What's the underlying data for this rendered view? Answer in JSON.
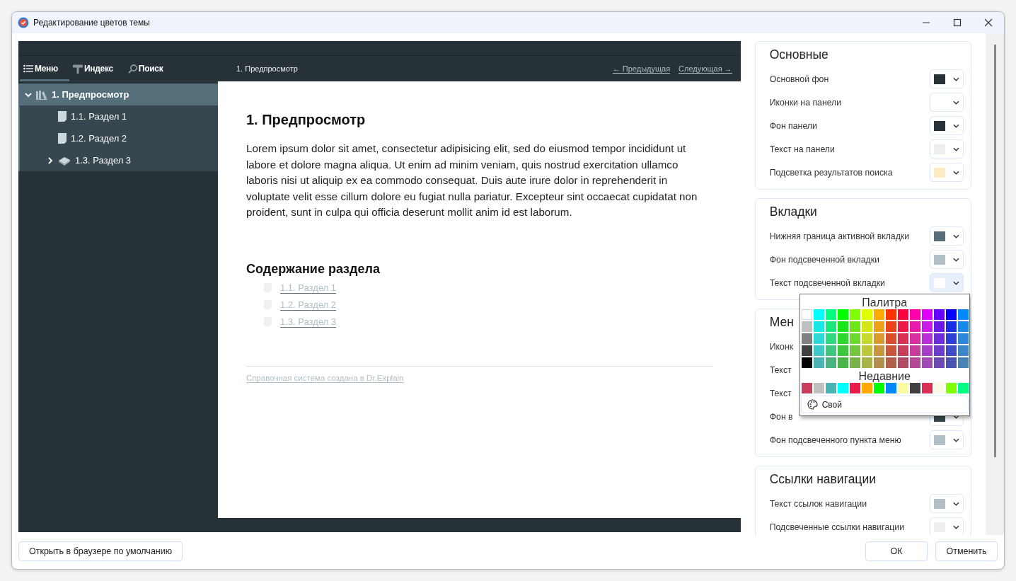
{
  "window": {
    "title": "Редактирование цветов темы"
  },
  "preview": {
    "tabs": [
      {
        "label": "Меню",
        "selected": true
      },
      {
        "label": "Индекс",
        "selected": false
      },
      {
        "label": "Поиск",
        "selected": false
      }
    ],
    "breadcrumb": "1. Предпросмотр",
    "prev_link": "← Предыдущая",
    "next_link": "Следующая →",
    "tree": [
      {
        "label": "1. Предпросмотр",
        "selected": true,
        "expanded": true,
        "children": [
          {
            "label": "1.1. Раздел 1",
            "selected": false
          },
          {
            "label": "1.2. Раздел 2",
            "selected": false
          },
          {
            "label": "1.3. Раздел 3",
            "selected": false,
            "expanded": false
          }
        ]
      }
    ],
    "heading": "1. Предпросмотр",
    "paragraph": "Lorem ipsum dolor sit amet, consectetur adipisicing elit, sed do eiusmod tempor incididunt ut labore et dolore magna aliqua. Ut enim ad minim veniam, quis nostrud exercitation ullamco laboris nisi ut aliquip ex ea commodo consequat. Duis aute irure dolor in reprehenderit in voluptate velit esse cillum dolore eu fugiat nulla pariatur. Excepteur sint occaecat cupidatat non proident, sunt in culpa qui officia deserunt mollit anim id est laborum.",
    "contents_heading": "Содержание раздела",
    "contents_links": [
      "1.1. Раздел 1",
      "1.2. Раздел 2",
      "1.3. Раздел 3"
    ],
    "footer_link": "Справочная система создана в Dr.Explain"
  },
  "sections": [
    {
      "title": "Основные",
      "rows": [
        {
          "label": "Основной фон",
          "color": "#263238",
          "open": false
        },
        {
          "label": "Иконки на панели",
          "color": "#ffffff",
          "open": false
        },
        {
          "label": "Фон панели",
          "color": "#263238",
          "open": false
        },
        {
          "label": "Текст на панели",
          "color": "#eeeeee",
          "open": false
        },
        {
          "label": "Подсветка результатов поиска",
          "color": "#ffecc6",
          "open": false
        }
      ]
    },
    {
      "title": "Вкладки",
      "rows": [
        {
          "label": "Нижняя граница активной вкладки",
          "color": "#546e7a",
          "open": false
        },
        {
          "label": "Фон подсвеченной вкладки",
          "color": "#b0bec5",
          "open": false
        },
        {
          "label": "Текст подсвеченной вкладки",
          "color": "#ffffff",
          "open": true
        }
      ]
    },
    {
      "title": "Мен",
      "rows": [
        {
          "label": "Иконк"
        },
        {
          "label": "Текст"
        },
        {
          "label": "Текст"
        },
        {
          "label": "Фон в",
          "color": "#37474f",
          "open": false
        },
        {
          "label": "Фон подсвеченного пункта меню",
          "color": "#b0bec5",
          "open": false
        }
      ]
    },
    {
      "title": "Ссылки навигации",
      "rows": [
        {
          "label": "Текст ссылок навигации",
          "color": "#b0bec5",
          "open": false
        },
        {
          "label": "Подсвеченные ссылки навигации",
          "color": "#eeeeee",
          "open": false
        }
      ]
    }
  ],
  "palette": {
    "title": "Палитра",
    "rows": [
      [
        {
          "color": "#ffffff",
          "selected": true
        },
        {
          "color": "#00ffff",
          "selected": false
        },
        {
          "color": "#00ff80",
          "selected": false
        },
        {
          "color": "#00ff00",
          "selected": false
        },
        {
          "color": "#80ff00",
          "selected": false
        },
        {
          "color": "#e0ff00",
          "selected": false
        },
        {
          "color": "#ffaa00",
          "selected": false
        },
        {
          "color": "#ff3300",
          "selected": false
        },
        {
          "color": "#ff0040",
          "selected": false
        },
        {
          "color": "#ff00aa",
          "selected": false
        },
        {
          "color": "#dd00ff",
          "selected": false
        },
        {
          "color": "#6600ff",
          "selected": false
        },
        {
          "color": "#0000ff",
          "selected": false
        },
        {
          "color": "#0088ff",
          "selected": false
        }
      ],
      [
        {
          "color": "#c0c0c0",
          "selected": false
        },
        {
          "color": "#1ae6e6",
          "selected": false
        },
        {
          "color": "#1ae680",
          "selected": false
        },
        {
          "color": "#1ae61a",
          "selected": false
        },
        {
          "color": "#6ee61a",
          "selected": false
        },
        {
          "color": "#d4e61a",
          "selected": false
        },
        {
          "color": "#eba21a",
          "selected": false
        },
        {
          "color": "#eb431a",
          "selected": false
        },
        {
          "color": "#eb1a4a",
          "selected": false
        },
        {
          "color": "#e81aaa",
          "selected": false
        },
        {
          "color": "#c91ae6",
          "selected": false
        },
        {
          "color": "#6a1ae6",
          "selected": false
        },
        {
          "color": "#1a2ee6",
          "selected": false
        },
        {
          "color": "#1a88e6",
          "selected": false
        }
      ],
      [
        {
          "color": "#808080",
          "selected": false
        },
        {
          "color": "#2ed9d9",
          "selected": false
        },
        {
          "color": "#2ed980",
          "selected": false
        },
        {
          "color": "#2ed92e",
          "selected": false
        },
        {
          "color": "#6ed92e",
          "selected": false
        },
        {
          "color": "#c8d92e",
          "selected": false
        },
        {
          "color": "#d99a2e",
          "selected": false
        },
        {
          "color": "#d94d2e",
          "selected": false
        },
        {
          "color": "#d92e55",
          "selected": false
        },
        {
          "color": "#d92ea0",
          "selected": false
        },
        {
          "color": "#b82ed9",
          "selected": false
        },
        {
          "color": "#6b2ed9",
          "selected": false
        },
        {
          "color": "#2e3fd9",
          "selected": false
        },
        {
          "color": "#2e88d9",
          "selected": false
        }
      ],
      [
        {
          "color": "#404040",
          "selected": false
        },
        {
          "color": "#3dc7c7",
          "selected": false
        },
        {
          "color": "#3dc780",
          "selected": false
        },
        {
          "color": "#3dc73d",
          "selected": false
        },
        {
          "color": "#73c73d",
          "selected": false
        },
        {
          "color": "#bcc73d",
          "selected": false
        },
        {
          "color": "#c7963d",
          "selected": false
        },
        {
          "color": "#c7573d",
          "selected": false
        },
        {
          "color": "#c73d5c",
          "selected": false
        },
        {
          "color": "#c73d9c",
          "selected": false
        },
        {
          "color": "#a83dc7",
          "selected": false
        },
        {
          "color": "#6c3dc7",
          "selected": false
        },
        {
          "color": "#3d4bc7",
          "selected": false
        },
        {
          "color": "#3d86c7",
          "selected": false
        }
      ],
      [
        {
          "color": "#000000",
          "selected": false
        },
        {
          "color": "#4ab3b3",
          "selected": false
        },
        {
          "color": "#4ab380",
          "selected": false
        },
        {
          "color": "#4ab34a",
          "selected": false
        },
        {
          "color": "#7ab34a",
          "selected": false
        },
        {
          "color": "#aab34a",
          "selected": false
        },
        {
          "color": "#b38f4a",
          "selected": false
        },
        {
          "color": "#b3604a",
          "selected": false
        },
        {
          "color": "#b34a63",
          "selected": false
        },
        {
          "color": "#b34a94",
          "selected": false
        },
        {
          "color": "#a04ab3",
          "selected": false
        },
        {
          "color": "#6d4ab3",
          "selected": false
        },
        {
          "color": "#4a52b3",
          "selected": false
        },
        {
          "color": "#4a83b3",
          "selected": false
        }
      ]
    ],
    "recent_title": "Недавние",
    "recent": [
      {
        "color": "#c73d5c",
        "selected": false
      },
      {
        "color": "#c0c0c0",
        "selected": false
      },
      {
        "color": "#4ab3b3",
        "selected": false
      },
      {
        "color": "#00ffff",
        "selected": false
      },
      {
        "color": "#eb1a4a",
        "selected": false
      },
      {
        "color": "#ffaa00",
        "selected": false
      },
      {
        "color": "#00ff00",
        "selected": false
      },
      {
        "color": "#0088ff",
        "selected": false
      },
      {
        "color": "#fafaa0",
        "selected": false
      },
      {
        "color": "#404040",
        "selected": false
      },
      {
        "color": "#d92e55",
        "selected": false
      },
      {
        "color": "#fafae6",
        "selected": false
      },
      {
        "color": "#80ff00",
        "selected": false
      },
      {
        "color": "#00ff80",
        "selected": false
      }
    ],
    "custom_button": "Свой"
  },
  "footer": {
    "open_browser_button": "Открыть в браузере по умолчанию",
    "ok_button": "ОК",
    "cancel_button": "Отменить"
  }
}
